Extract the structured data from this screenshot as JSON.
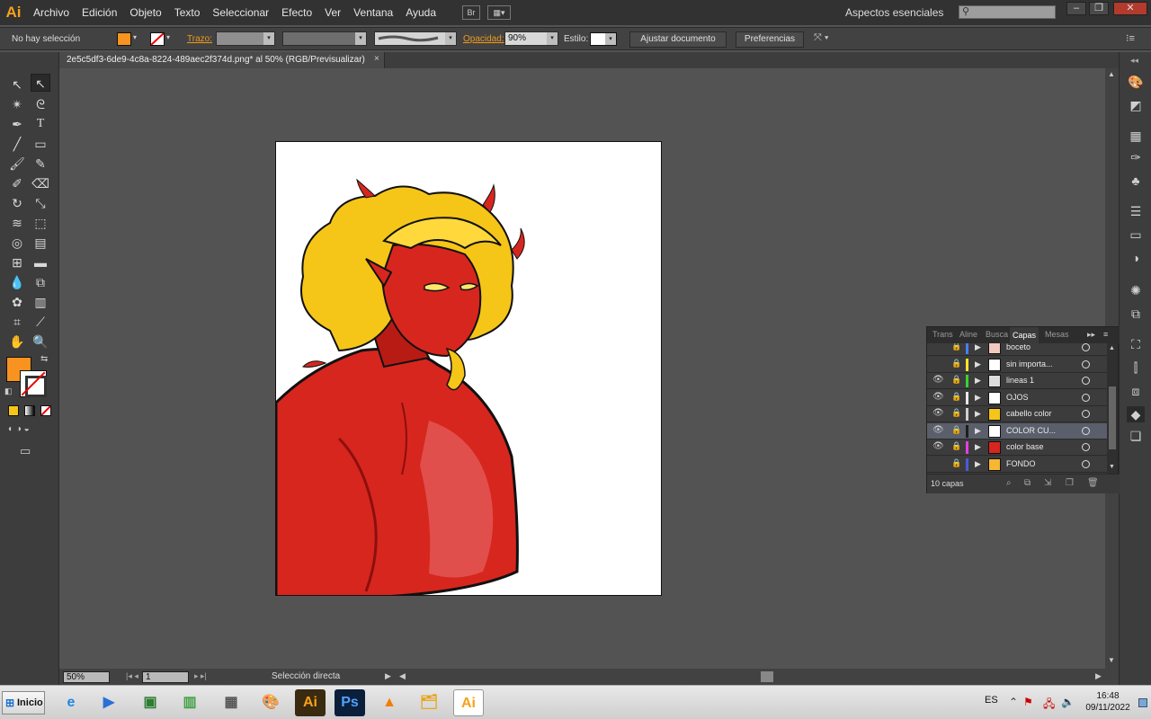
{
  "menubar": {
    "logo": "Ai",
    "items": [
      "Archivo",
      "Edición",
      "Objeto",
      "Texto",
      "Seleccionar",
      "Efecto",
      "Ver",
      "Ventana",
      "Ayuda"
    ],
    "bridge_label": "Br",
    "workspace": "Aspectos esenciales",
    "workspace_arrow": "▾"
  },
  "controlbar": {
    "selection_status": "No hay selección",
    "fill_color": "#f7931e",
    "stroke_label": "Trazo:",
    "opacity_label": "Opacidad:",
    "opacity_value": "90%",
    "style_label": "Estilo:",
    "fit_document_button": "Ajustar documento",
    "preferences_button": "Preferencias"
  },
  "document": {
    "tab_title": "2e5c5df3-6de9-4c8a-8224-489aec2f374d.png* al 50% (RGB/Previsualizar)",
    "close": "×"
  },
  "statusbar": {
    "zoom": "50%",
    "page": "1",
    "tool_status": "Selección directa"
  },
  "layers_panel": {
    "tabs": [
      "Trans",
      "Aline",
      "Busca",
      "Capas",
      "Mesas"
    ],
    "active_tab": "Capas",
    "layers": [
      {
        "name": "boceto",
        "visible": false,
        "color": "#4a7cff",
        "thumb": "#f2c9c0"
      },
      {
        "name": "sin importa...",
        "visible": false,
        "color": "#ffe62b",
        "thumb": "#ffffff"
      },
      {
        "name": "lineas 1",
        "visible": true,
        "color": "#33d633",
        "thumb": "#dddddd"
      },
      {
        "name": "OJOS",
        "visible": true,
        "color": "#e8e8e8",
        "thumb": "#ffffff"
      },
      {
        "name": "cabello color",
        "visible": true,
        "color": "#cfcfcf",
        "thumb": "#f5c518"
      },
      {
        "name": "COLOR CU...",
        "visible": true,
        "color": "#1e1e1e",
        "thumb": "#ffffff",
        "selected": true
      },
      {
        "name": "color base",
        "visible": true,
        "color": "#e040e0",
        "thumb": "#d7261e"
      },
      {
        "name": "FONDO",
        "visible": false,
        "color": "#4a5bd6",
        "thumb": "#f7b733"
      }
    ],
    "count": "10 capas"
  },
  "taskbar": {
    "start": "Inicio",
    "language": "ES",
    "time": "16:48",
    "date": "09/11/2022"
  },
  "colors": {
    "accent": "#f7a21b",
    "skin": "#d7261e",
    "hair": "#f5c518"
  }
}
